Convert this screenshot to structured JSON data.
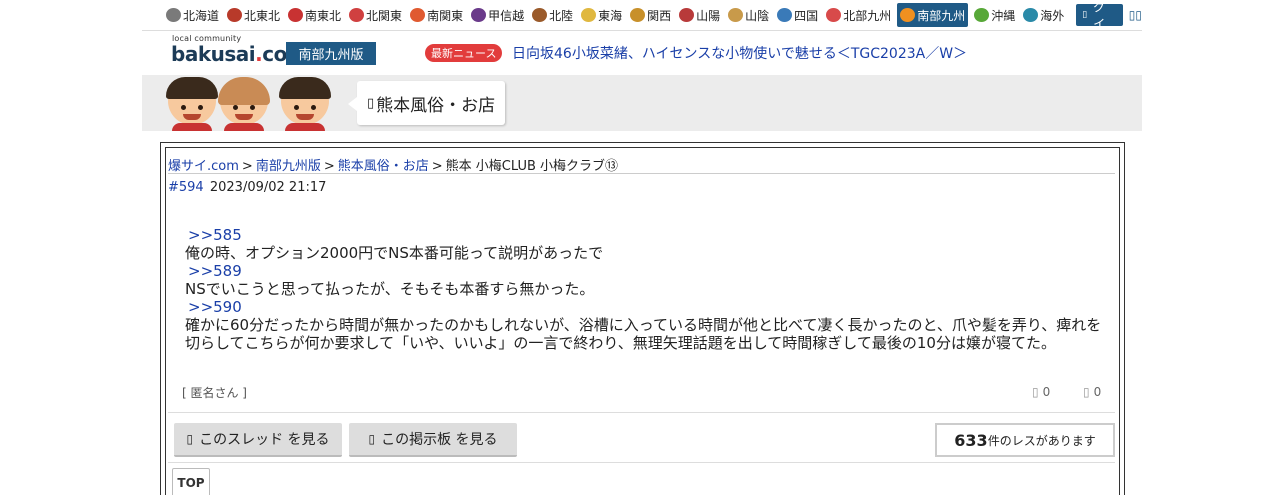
{
  "regions": [
    {
      "label": "北海道",
      "color": "#7a7a7a"
    },
    {
      "label": "北東北",
      "color": "#b83a2a"
    },
    {
      "label": "南東北",
      "color": "#c83232"
    },
    {
      "label": "北関東",
      "color": "#d04040"
    },
    {
      "label": "南関東",
      "color": "#e05a30"
    },
    {
      "label": "甲信越",
      "color": "#6a3a8a"
    },
    {
      "label": "北陸",
      "color": "#9a5a2a"
    },
    {
      "label": "東海",
      "color": "#e0b840"
    },
    {
      "label": "関西",
      "color": "#c8902a"
    },
    {
      "label": "山陽",
      "color": "#b83a3a"
    },
    {
      "label": "山陰",
      "color": "#c89a4a"
    },
    {
      "label": "四国",
      "color": "#3a7ab8"
    },
    {
      "label": "北部九州",
      "color": "#d84a4a"
    },
    {
      "label": "南部九州",
      "color": "#f09020",
      "active": true
    },
    {
      "label": "沖縄",
      "color": "#58a838"
    },
    {
      "label": "海外",
      "color": "#2a8aa8"
    }
  ],
  "login_label": "ログイン",
  "logo": {
    "small": "local community",
    "main": "bakusai",
    "dot": ".",
    "tld": "com"
  },
  "edition": "南部九州版",
  "news": {
    "badge": "最新ニュース",
    "headline": "日向坂46小坂菜緒、ハイセンスな小物使いで魅せる＜TGC2023A／W＞"
  },
  "board_title": "熊本風俗・お店",
  "breadcrumb": {
    "home": "爆サイ.com",
    "edition": "南部九州版",
    "board": "熊本風俗・お店",
    "thread": "熊本 小梅CLUB 小梅クラブ⑬",
    "sep": ">"
  },
  "post": {
    "number": "#594",
    "date": "2023/09/02 21:17",
    "lines": [
      {
        "type": "anchor",
        "text": ">>585"
      },
      {
        "type": "text",
        "text": "俺の時、オプション2000円でNS本番可能って説明があったで"
      },
      {
        "type": "anchor",
        "text": ">>589"
      },
      {
        "type": "text",
        "text": "NSでいこうと思って払ったが、そもそも本番すら無かった。"
      },
      {
        "type": "anchor",
        "text": ">>590"
      },
      {
        "type": "text",
        "text": "確かに60分だったから時間が無かったのかもしれないが、浴槽に入っている時間が他と比べて凄く長かったのと、爪や髪を弄り、痺れを切らしてこちらが何か要求して「いや、いいよ」の一言で終わり、無理矢理話題を出して時間稼ぎして最後の10分は嬢が寝てた。"
      }
    ],
    "author": "[ 匿名さん ]",
    "likes": "0",
    "dislikes": "0"
  },
  "buttons": {
    "thread": "このスレッド を見る",
    "board": "この掲示板 を見る"
  },
  "res_count": {
    "number": "633",
    "suffix": "件のレスがあります"
  },
  "top_label": "TOP"
}
